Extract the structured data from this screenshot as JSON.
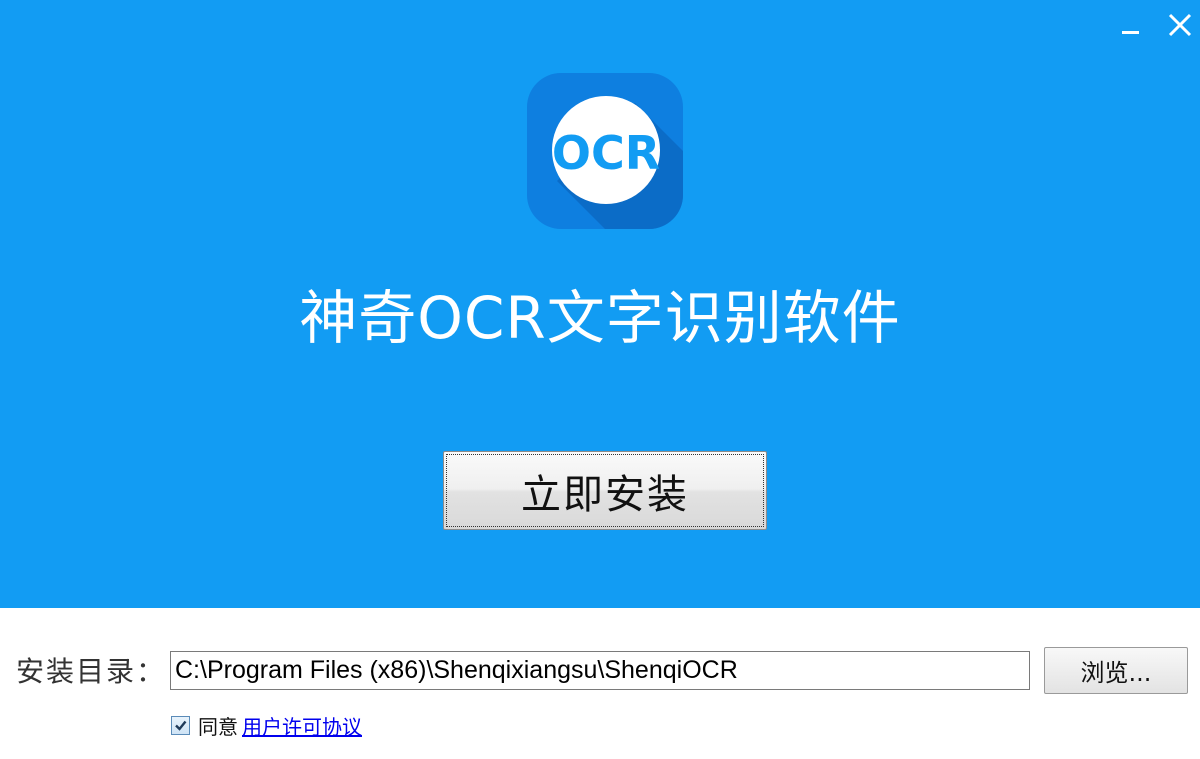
{
  "window": {
    "minimize_icon": "minimize-icon",
    "close_icon": "close-icon"
  },
  "logo": {
    "text": "OCR",
    "icon": "ocr-logo-icon",
    "colors": {
      "tile": "#0e7fe0",
      "circle": "#ffffff",
      "text": "#129cf3"
    }
  },
  "app": {
    "title": "神奇OCR文字识别软件"
  },
  "install": {
    "button_label": "立即安装"
  },
  "directory": {
    "label": "安装目录：",
    "value": "C:\\Program Files (x86)\\Shenqixiangsu\\ShenqiOCR",
    "browse_label": "浏览..."
  },
  "agreement": {
    "checked": true,
    "prefix": "同意",
    "link_text": "用户许可协议"
  },
  "colors": {
    "hero_background": "#129cf3",
    "link": "#0000ee"
  }
}
